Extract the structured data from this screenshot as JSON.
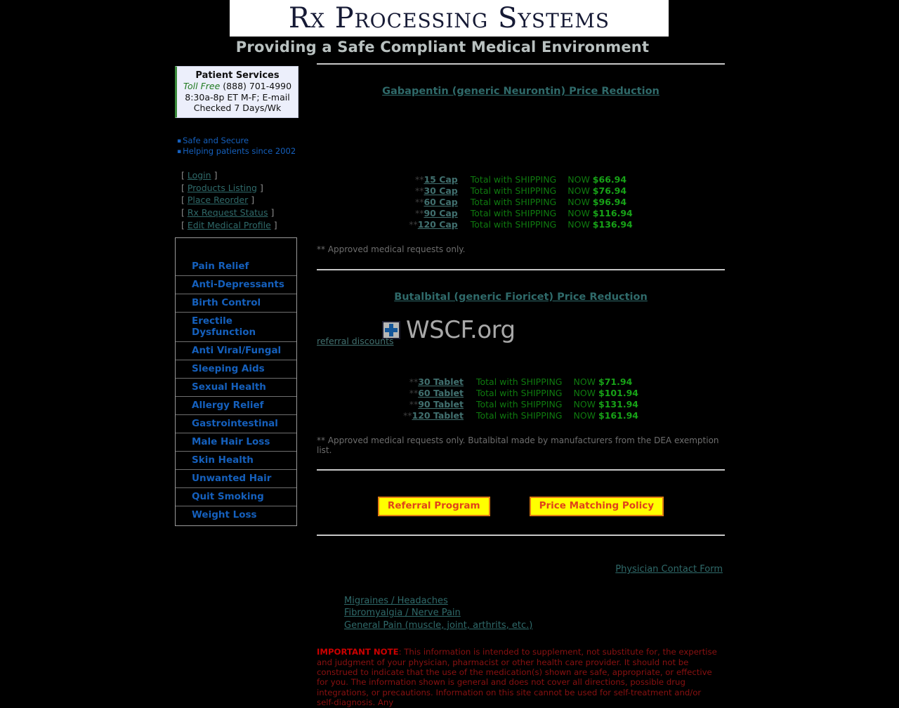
{
  "header": {
    "logo_text": "Rx Processing Systems",
    "tagline": "Providing a Safe Compliant Medical Environment"
  },
  "patient_services": {
    "title": "Patient Services",
    "toll_free_label": "Toll Free",
    "phone": "(888) 701-4990",
    "hours": "8:30a-8p ET M-F; E-mail",
    "email_note": "Checked 7 Days/Wk"
  },
  "bullets": [
    "Safe and Secure",
    "Helping patients since 2002"
  ],
  "quick_links": [
    "Login",
    "Products Listing",
    "Place Reorder",
    "Rx Request Status",
    "Edit Medical Profile"
  ],
  "categories": [
    "Pain Relief",
    "Anti-Depressants",
    "Birth Control",
    "Erectile Dysfunction",
    "Anti Viral/Fungal",
    "Sleeping Aids",
    "Sexual Health",
    "Allergy Relief",
    "Gastrointestinal",
    "Male Hair Loss",
    "Skin Health",
    "Unwanted Hair",
    "Quit Smoking",
    "Weight Loss"
  ],
  "promo1": {
    "heading": "Gabapentin (generic Neurontin) Price Reduction",
    "stars": "**",
    "shipping_label": "Total with SHIPPING",
    "now_label": "NOW",
    "rows": [
      {
        "qty": "15 Cap",
        "price": "$66.94"
      },
      {
        "qty": "30 Cap",
        "price": "$76.94"
      },
      {
        "qty": "60 Cap",
        "price": "$96.94"
      },
      {
        "qty": "90 Cap",
        "price": "$116.94"
      },
      {
        "qty": "120 Cap",
        "price": "$136.94"
      }
    ],
    "footnote": "** Approved medical requests only."
  },
  "promo2": {
    "heading": "Butalbital (generic Fioricet) Price Reduction",
    "stars": "**",
    "shipping_label": "Total with SHIPPING",
    "now_label": "NOW",
    "rows": [
      {
        "qty": "30 Tablet",
        "price": "$71.94"
      },
      {
        "qty": "60 Tablet",
        "price": "$101.94"
      },
      {
        "qty": "90 Tablet",
        "price": "$131.94"
      },
      {
        "qty": "120 Tablet",
        "price": "$161.94"
      }
    ],
    "footnote": "** Approved medical requests only. Butalbital made by manufacturers from the DEA exemption list."
  },
  "watermark": {
    "text": "WSCF.org",
    "icon": "medical-cross-icon"
  },
  "referral_discounts_link": "referral discounts",
  "buttons": {
    "referral_program": "Referral Program",
    "price_matching": "Price Matching Policy"
  },
  "physician_contact_link": "Physician Contact Form",
  "condition_links": [
    "Migraines / Headaches",
    "Fibromyalgia / Nerve Pain",
    "General Pain (muscle, joint, arthrits, etc.)"
  ],
  "important_note": {
    "label": "IMPORTANT NOTE",
    "body": ": This information is intended to supplement, not substitute for, the expertise and judgment of your physician, pharmacist or other health care provider. It should not be construed to indicate that the use of the medication(s) shown are safe, appropriate, or effective for you. The information shown is general and does not cover all directions, possible drug integrations, or precautions. Information on this site cannot be used for self-treatment and/or self-diagnosis. Any"
  },
  "colors": {
    "background": "#000000",
    "link_teal": "#2f6a6a",
    "category_blue": "#1560bd",
    "price_green": "#17a217",
    "button_yellow": "#ffff00",
    "button_text": "#e0431a",
    "warning_red": "#cc0000"
  }
}
